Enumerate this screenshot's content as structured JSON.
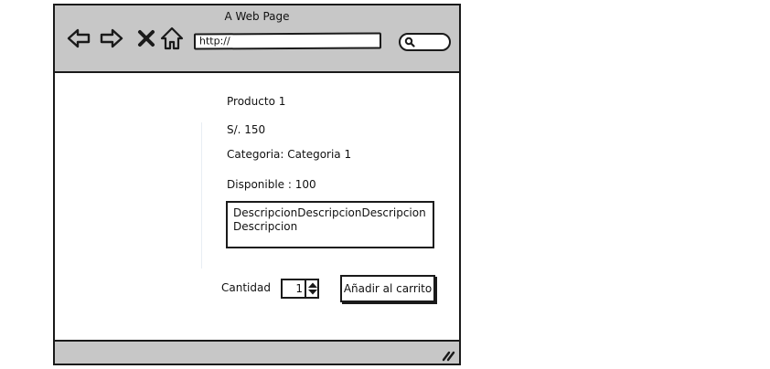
{
  "window": {
    "title": "A Web Page"
  },
  "toolbar": {
    "back_icon": "back-arrow-icon",
    "forward_icon": "forward-arrow-icon",
    "stop_icon": "close-icon",
    "home_icon": "home-icon",
    "url_value": "http://",
    "search_icon": "search-icon"
  },
  "product": {
    "name": "Producto 1",
    "price": "S/. 150",
    "category": "Categoria: Categoria 1",
    "available": "Disponible : 100",
    "description": "DescripcionDescripcionDescripcion Descripcion"
  },
  "purchase": {
    "quantity_label": "Cantidad",
    "quantity_value": "1",
    "add_to_cart_label": "Añadir al carrito"
  },
  "colors": {
    "chrome": "#c7c7c7",
    "border": "#1a1a1a",
    "background": "#ffffff"
  }
}
